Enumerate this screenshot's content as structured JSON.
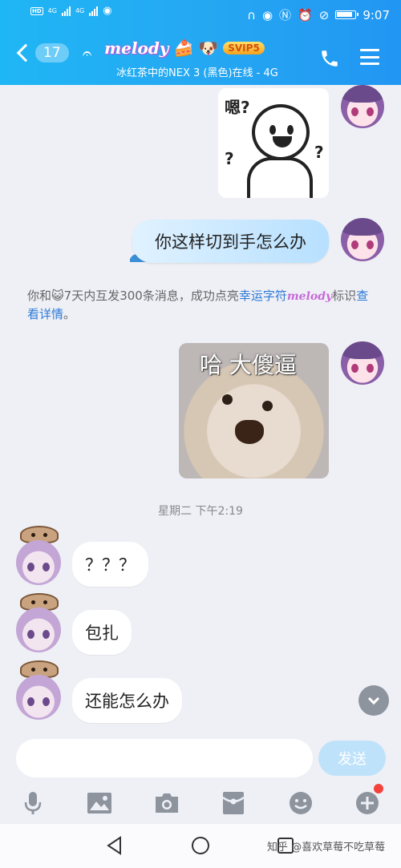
{
  "status_bar": {
    "network_left": "4G",
    "network_right": "4G",
    "time": "9:07"
  },
  "title_bar": {
    "back_count": "17",
    "nickname": "melody",
    "badge": "SVIP5",
    "subtitle": "冰红茶中的NEX 3 (黑色)在线 - 4G"
  },
  "messages": {
    "sticker1_text_top": "嗯?",
    "sticker1_q1": "?",
    "sticker1_q2": "?",
    "outgoing_text": "你这样切到手怎么办",
    "system_notice_prefix": "你和",
    "system_notice_emoji": "😺",
    "system_notice_mid": "7天内互发300条消息，成功点亮",
    "system_notice_highlight": "幸运字符",
    "system_notice_mark": "melody",
    "system_notice_suffix1": "标识",
    "system_notice_link": "查看详情",
    "system_notice_suffix2": "。",
    "sticker2_text": "哈 大傻逼",
    "timestamp": "星期二 下午2:19",
    "incoming": [
      "？？？",
      "包扎",
      "还能怎么办"
    ]
  },
  "composer": {
    "placeholder": "",
    "send_label": "发送"
  },
  "toolbar_icons": [
    "microphone-icon",
    "image-icon",
    "camera-icon",
    "red-packet-icon",
    "emoji-icon",
    "plus-icon"
  ],
  "watermark": "知乎 @喜欢草莓不吃草莓",
  "colors": {
    "header": "#25a8f2",
    "outgoing_bubble": "#b7e0ff",
    "link": "#2d79d6",
    "send_button": "#bfe2fb"
  }
}
